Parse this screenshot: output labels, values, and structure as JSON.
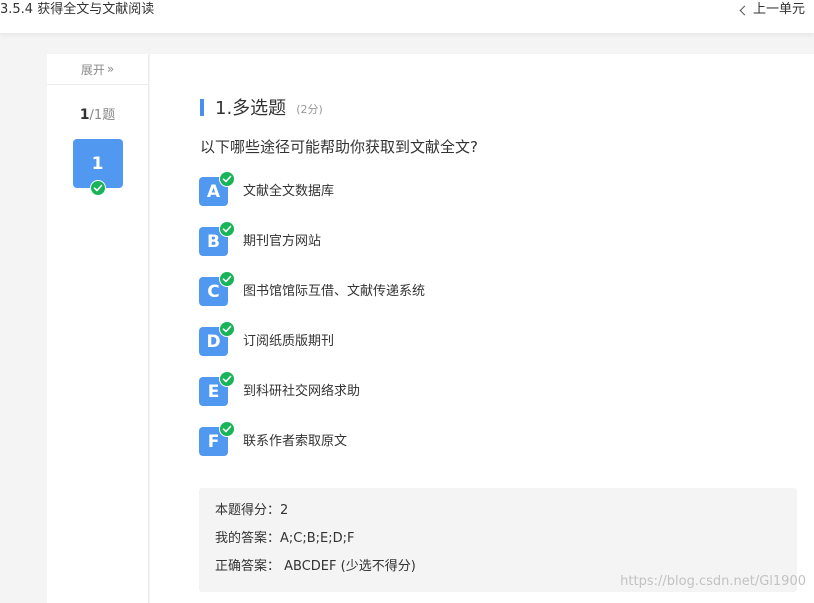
{
  "topbar": {
    "unit_title": "3.5.4 获得全文与文献阅读",
    "prev_unit": "上一单元"
  },
  "sidebar": {
    "expand_label": "展开",
    "expand_glyph": "»",
    "current": "1",
    "total": "/1题",
    "question_number": "1"
  },
  "question": {
    "title": "1.多选题",
    "score": "(2分)",
    "text": "以下哪些途径可能帮助你获取到文献全文?",
    "options": [
      {
        "letter": "A",
        "text": "文献全文数据库"
      },
      {
        "letter": "B",
        "text": "期刊官方网站"
      },
      {
        "letter": "C",
        "text": "图书馆馆际互借、文献传递系统"
      },
      {
        "letter": "D",
        "text": "订阅纸质版期刊"
      },
      {
        "letter": "E",
        "text": "到科研社交网络求助"
      },
      {
        "letter": "F",
        "text": "联系作者索取原文"
      }
    ]
  },
  "result": {
    "score": "本题得分：2",
    "my_answer": "我的答案：A;C;B;E;D;F",
    "correct_answer": "正确答案： ABCDEF (少选不得分)"
  },
  "watermark": "https://blog.csdn.net/Gl1900",
  "colors": {
    "accent": "#5198f0",
    "check": "#19b45a"
  }
}
